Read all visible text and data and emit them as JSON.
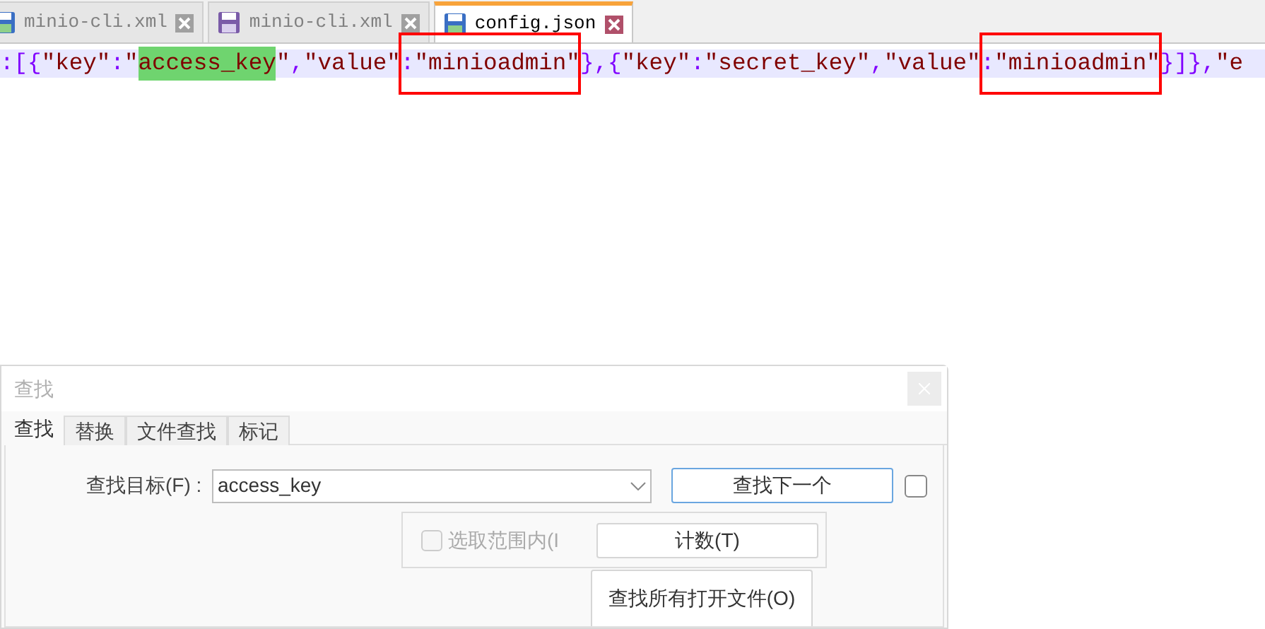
{
  "tabs": [
    {
      "label": "minio-cli.xml",
      "selected": false,
      "modified": false
    },
    {
      "label": "minio-cli.xml",
      "selected": false,
      "modified": true
    },
    {
      "label": "config.json",
      "selected": true,
      "modified": false
    }
  ],
  "editor_line": [
    {
      "boxed": false,
      "tokens": [
        {
          "text": ":[{",
          "kind": "operator",
          "highlighted": false
        },
        {
          "text": "\"key\"",
          "kind": "string",
          "highlighted": false
        },
        {
          "text": ":",
          "kind": "operator",
          "highlighted": false
        },
        {
          "text": "\"",
          "kind": "string",
          "highlighted": false
        },
        {
          "text": "access_key",
          "kind": "string",
          "highlighted": true
        },
        {
          "text": "\"",
          "kind": "string",
          "highlighted": false
        },
        {
          "text": ",",
          "kind": "operator",
          "highlighted": false
        },
        {
          "text": "\"value\"",
          "kind": "string",
          "highlighted": false
        }
      ]
    },
    {
      "boxed": true,
      "tokens": [
        {
          "text": ":",
          "kind": "operator",
          "highlighted": false
        },
        {
          "text": "\"minioadmin\"",
          "kind": "string",
          "highlighted": false
        }
      ]
    },
    {
      "boxed": false,
      "tokens": [
        {
          "text": "},{",
          "kind": "operator",
          "highlighted": false
        },
        {
          "text": "\"key\"",
          "kind": "string",
          "highlighted": false
        },
        {
          "text": ":",
          "kind": "operator",
          "highlighted": false
        },
        {
          "text": "\"secret_key\"",
          "kind": "string",
          "highlighted": false
        },
        {
          "text": ",",
          "kind": "operator",
          "highlighted": false
        },
        {
          "text": "\"value\"",
          "kind": "string",
          "highlighted": false
        }
      ]
    },
    {
      "boxed": true,
      "tokens": [
        {
          "text": ":",
          "kind": "operator",
          "highlighted": false
        },
        {
          "text": "\"minioadmin\"",
          "kind": "string",
          "highlighted": false
        }
      ]
    },
    {
      "boxed": false,
      "tokens": [
        {
          "text": "}]},",
          "kind": "operator",
          "highlighted": false
        },
        {
          "text": "\"e",
          "kind": "string",
          "highlighted": false
        }
      ]
    }
  ],
  "find_dialog": {
    "title": "查找",
    "tabs": [
      {
        "label": "查找",
        "selected": true
      },
      {
        "label": "替换",
        "selected": false
      },
      {
        "label": "文件查找",
        "selected": false
      },
      {
        "label": "标记",
        "selected": false
      }
    ],
    "find_label": "查找目标(F) :",
    "find_value": "access_key",
    "find_next_button": "查找下一个",
    "side_checkbox_checked": false,
    "in_selection": {
      "label": "选取范围内(I",
      "checked": false,
      "disabled": true
    },
    "count_button": "计数(T)",
    "find_all_open_button": "查找所有打开文件(O)"
  }
}
